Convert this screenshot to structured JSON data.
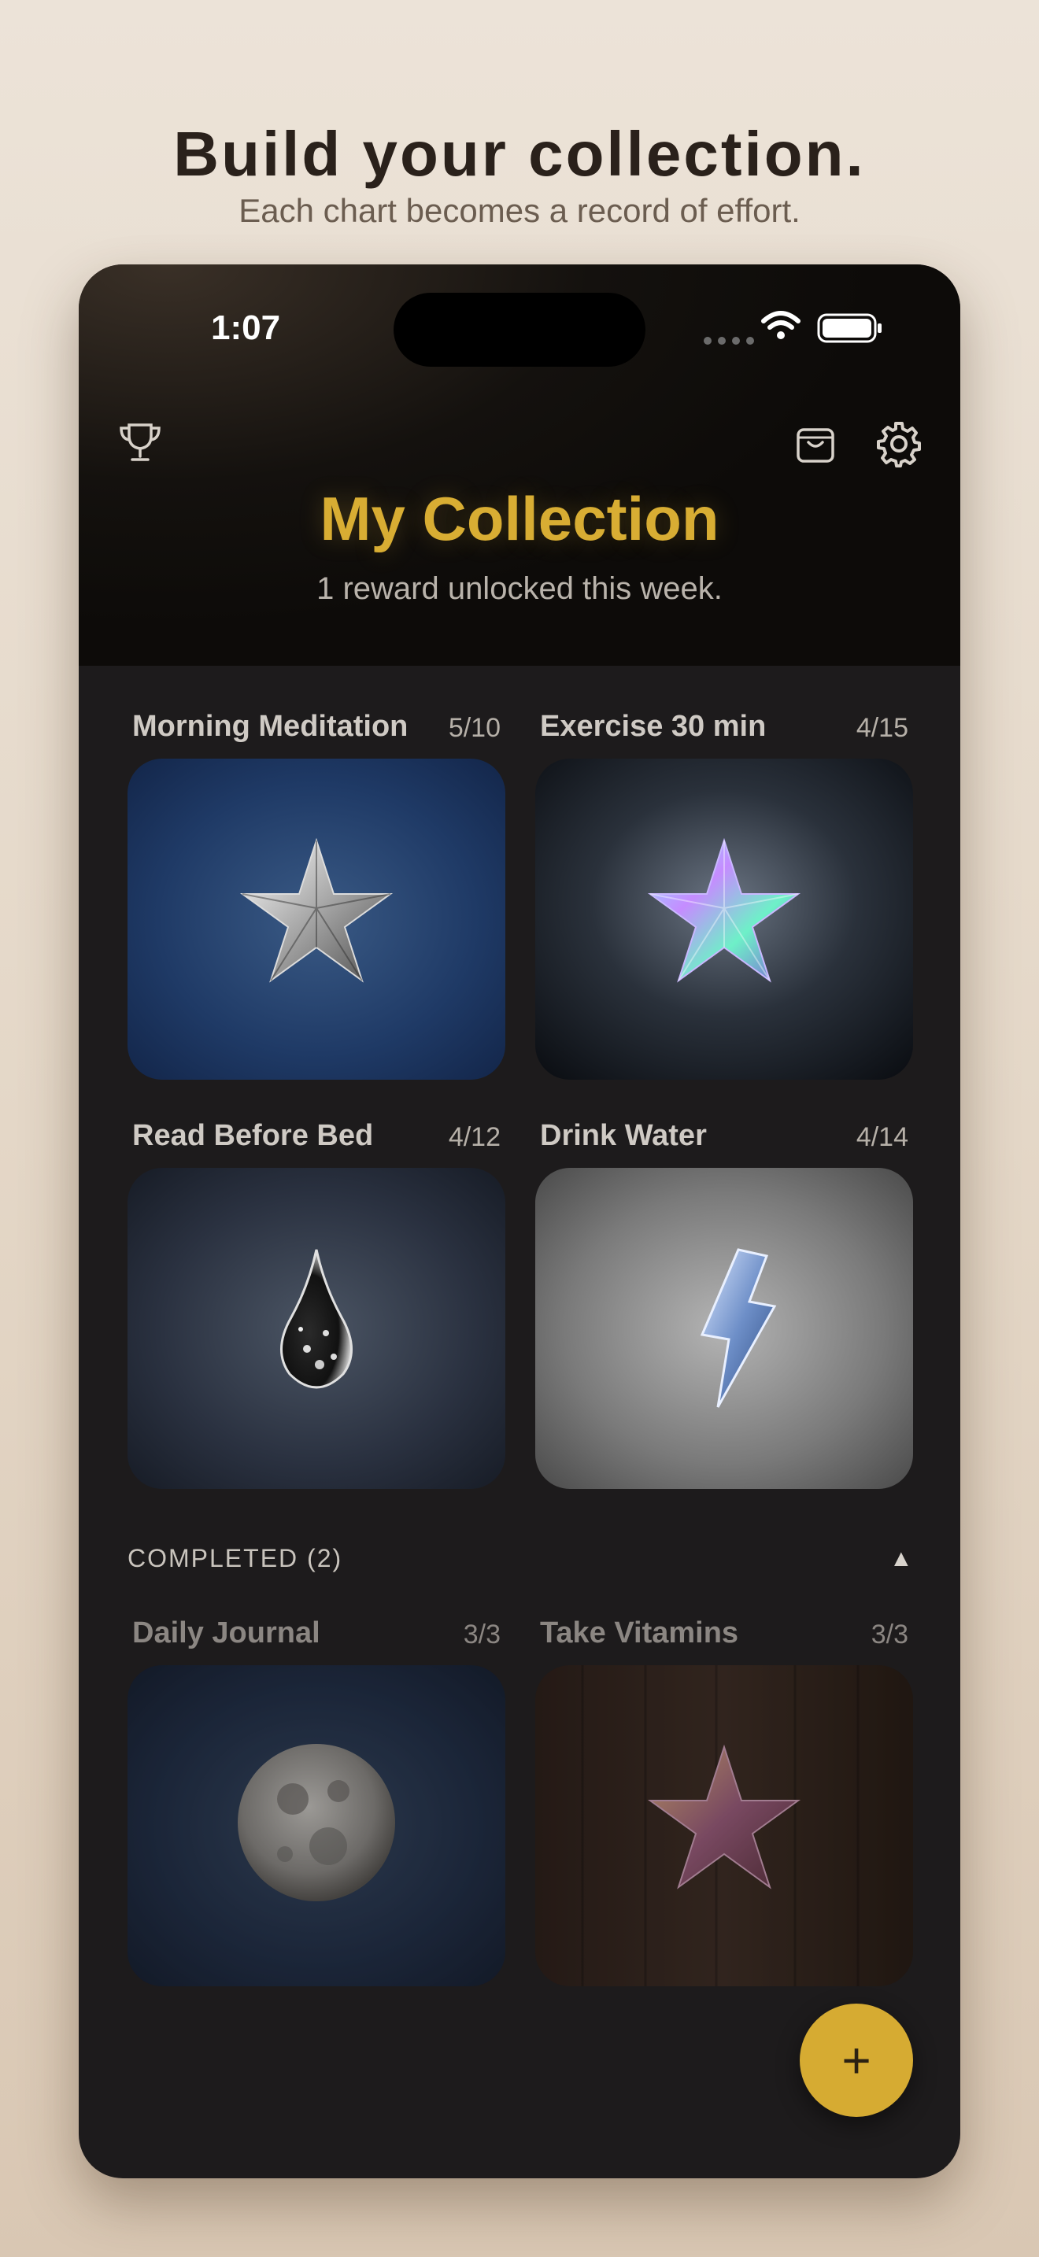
{
  "promo": {
    "title": "Build your collection.",
    "subtitle": "Each chart becomes a record of effort."
  },
  "status_bar": {
    "time": "1:07"
  },
  "toolbar": {
    "left_icon": "trophy-icon",
    "right_icons": [
      "shopping-bag-icon",
      "gear-icon"
    ]
  },
  "header": {
    "title": "My Collection",
    "subtitle": "1 reward unlocked this week."
  },
  "active_charts": [
    {
      "name": "Morning Meditation",
      "progress": "5/10",
      "reward": "silver-star"
    },
    {
      "name": "Exercise 30 min",
      "progress": "4/15",
      "reward": "iridescent-star"
    },
    {
      "name": "Read Before Bed",
      "progress": "4/12",
      "reward": "water-drop"
    },
    {
      "name": "Drink Water",
      "progress": "4/14",
      "reward": "ice-lightning-bolt"
    }
  ],
  "completed_section": {
    "label": "COMPLETED (2)",
    "toggle": "▲",
    "charts": [
      {
        "name": "Daily Journal",
        "progress": "3/3",
        "reward": "full-moon"
      },
      {
        "name": "Take Vitamins",
        "progress": "3/3",
        "reward": "bronze-star"
      }
    ]
  },
  "fab": {
    "label": "+"
  },
  "colors": {
    "accent": "#d8ad33",
    "background": "#1d1b1c",
    "page_background": "#ece3d8"
  }
}
